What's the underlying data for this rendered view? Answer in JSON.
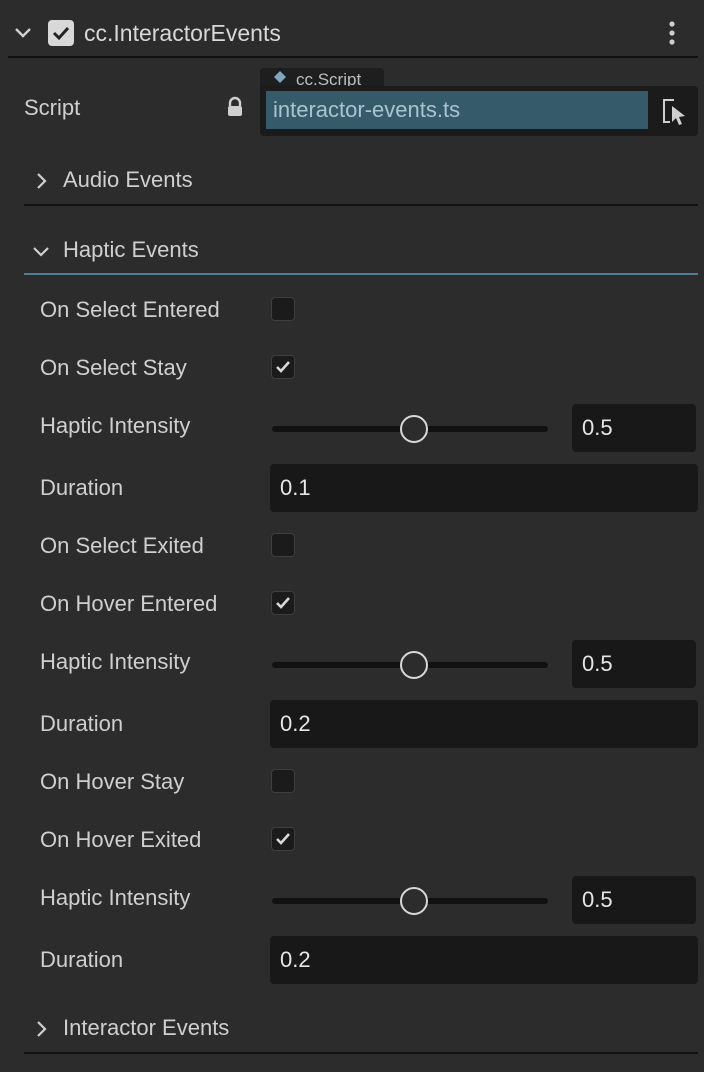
{
  "component": {
    "title": "cc.InteractorEvents",
    "enabled": true
  },
  "script": {
    "label": "Script",
    "type_tag": "cc.Script",
    "value": "interactor-events.ts"
  },
  "sections": {
    "audio": {
      "title": "Audio Events",
      "expanded": false
    },
    "haptic": {
      "title": "Haptic Events",
      "expanded": true
    },
    "interactor": {
      "title": "Interactor Events",
      "expanded": false
    }
  },
  "haptic_rows": {
    "select_entered": {
      "label": "On Select Entered",
      "checked": false
    },
    "select_stay": {
      "label": "On Select Stay",
      "checked": true
    },
    "intensity_1": {
      "label": "Haptic Intensity",
      "value": "0.5",
      "fraction": 0.5
    },
    "duration_1": {
      "label": "Duration",
      "value": "0.1"
    },
    "select_exited": {
      "label": "On Select Exited",
      "checked": false
    },
    "hover_entered": {
      "label": "On Hover Entered",
      "checked": true
    },
    "intensity_2": {
      "label": "Haptic Intensity",
      "value": "0.5",
      "fraction": 0.5
    },
    "duration_2": {
      "label": "Duration",
      "value": "0.2"
    },
    "hover_stay": {
      "label": "On Hover Stay",
      "checked": false
    },
    "hover_exited": {
      "label": "On Hover Exited",
      "checked": true
    },
    "intensity_3": {
      "label": "Haptic Intensity",
      "value": "0.5",
      "fraction": 0.5
    },
    "duration_3": {
      "label": "Duration",
      "value": "0.2"
    }
  },
  "colors": {
    "panel_bg": "#2c2c2c",
    "script_field_bg": "#355b6b",
    "accent_divider": "#4f7f93"
  },
  "icons": [
    "chevron-down-icon",
    "checkbox-checked-icon",
    "kebab-menu-icon",
    "lock-icon",
    "diamond-icon",
    "select-pointer-icon",
    "chevron-right-icon"
  ]
}
